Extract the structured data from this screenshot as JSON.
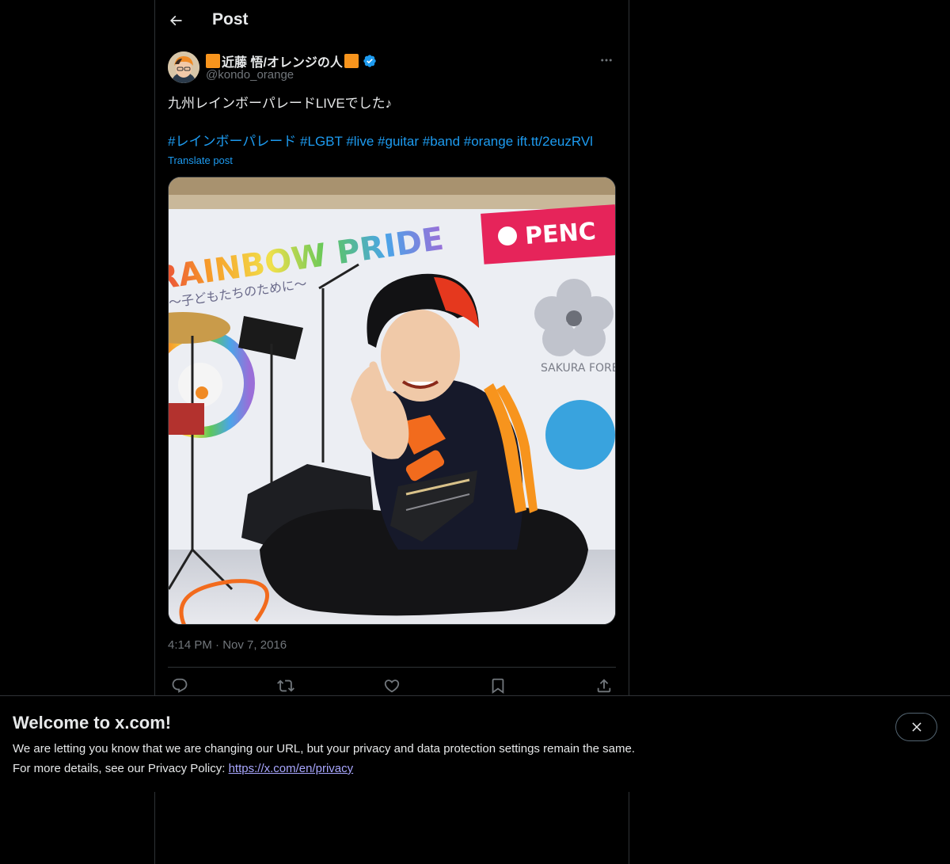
{
  "header": {
    "title": "Post",
    "back_icon": "arrow-left-icon"
  },
  "author": {
    "display_name": "近藤 悟/オレンジの人",
    "name_decoration_color": "#f7941d",
    "handle": "@kondo_orange",
    "verified": true,
    "verified_color": "#1d9bf0"
  },
  "post": {
    "text": "九州レインボーパレードLIVEでした♪",
    "hashtags": [
      "#レインボーパレード",
      "#LGBT",
      "#live",
      "#guitar",
      "#band",
      "#orange"
    ],
    "link": "ift.tt/2euzRVl",
    "translate_label": "Translate post",
    "time": "4:14 PM",
    "separator": "·",
    "date": "Nov 7, 2016"
  },
  "image_text": {
    "banner_left": "RAINBOW PRIDE",
    "banner_left_sub": "〜子どもたちのために〜",
    "banner_right": "PENC",
    "sakura": "SAKURA FORE"
  },
  "actions": {
    "reply_icon": "reply-icon",
    "repost_icon": "repost-icon",
    "like_icon": "heart-icon",
    "bookmark_icon": "bookmark-icon",
    "share_icon": "share-icon"
  },
  "banner": {
    "title": "Welcome to x.com!",
    "line1": "We are letting you know that we are changing our URL, but your privacy and data protection settings remain the same.",
    "line2_prefix": "For more details, see our Privacy Policy: ",
    "link": "https://x.com/en/privacy"
  },
  "colors": {
    "background": "#000000",
    "text": "#e7e9ea",
    "muted": "#71767b",
    "accent": "#1d9bf0",
    "link_purple": "#a9a7ff"
  }
}
